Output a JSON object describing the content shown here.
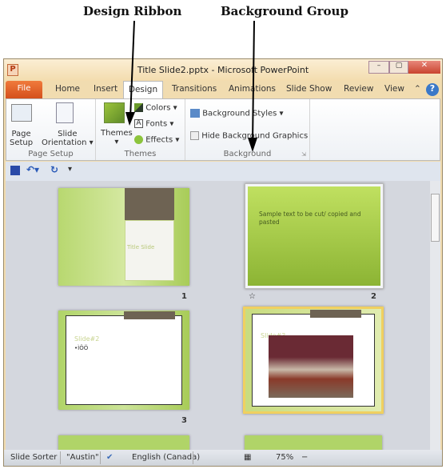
{
  "annotations": {
    "design_ribbon": "Design Ribbon",
    "background_group": "Background Group"
  },
  "window": {
    "title": "Title Slide2.pptx - Microsoft PowerPoint",
    "app_icon": "P"
  },
  "tabs": [
    "File",
    "Home",
    "Insert",
    "Design",
    "Transitions",
    "Animations",
    "Slide Show",
    "Review",
    "View"
  ],
  "active_tab": "Design",
  "ribbon": {
    "page_setup": {
      "label": "Page Setup",
      "page_setup": "Page\nSetup",
      "slide_orientation": "Slide\nOrientation ▾"
    },
    "themes": {
      "label": "Themes",
      "themes": "Themes",
      "colors": "Colors ▾",
      "fonts": "Fonts ▾",
      "effects": "Effects ▾"
    },
    "background": {
      "label": "Background",
      "background_styles": "Background Styles ▾",
      "hide_graphics": "Hide Background Graphics",
      "hide_graphics_checked": false
    }
  },
  "slides": [
    {
      "number": "1",
      "text": "Title Slide"
    },
    {
      "number": "2",
      "text": "Sample text to be cut/ copied and pasted",
      "selected": true
    },
    {
      "number": "3",
      "title": "Slide#2",
      "bullet": "•ÌÖÖ"
    },
    {
      "number": "",
      "title": "Slide#3",
      "active": true
    }
  ],
  "status": {
    "view": "Slide Sorter",
    "theme": "\"Austin\"",
    "language": "English (Canada)",
    "zoom": "75%"
  },
  "colors": {
    "file_tab": "#e0602a",
    "accent": "#9cc43c",
    "slide_brown": "#6e6353"
  }
}
